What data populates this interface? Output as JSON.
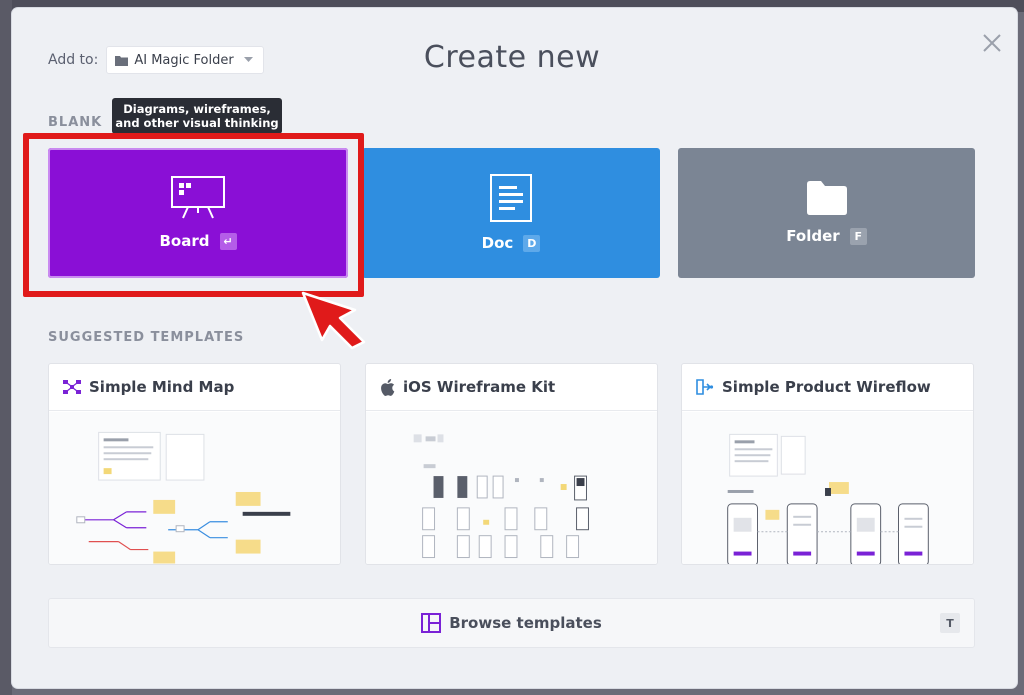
{
  "dialog": {
    "title": "Create new",
    "add_to_label": "Add to:",
    "folder_name": "AI Magic Folder"
  },
  "blank": {
    "section_label": "BLANK",
    "tooltip_line1": "Diagrams, wireframes,",
    "tooltip_line2": "and other visual thinking",
    "cards": [
      {
        "label": "Board",
        "shortcut": "↵",
        "icon": "board-icon",
        "color": "#8a0fd6"
      },
      {
        "label": "Doc",
        "shortcut": "D",
        "icon": "doc-icon",
        "color": "#2f8ee0"
      },
      {
        "label": "Folder",
        "shortcut": "F",
        "icon": "folder-icon",
        "color": "#7b8594"
      }
    ]
  },
  "templates": {
    "section_label": "SUGGESTED TEMPLATES",
    "items": [
      {
        "name": "Simple Mind Map",
        "icon": "mind-map-icon"
      },
      {
        "name": "iOS Wireframe Kit",
        "icon": "apple-icon"
      },
      {
        "name": "Simple Product Wireflow",
        "icon": "wireflow-icon"
      }
    ]
  },
  "browse": {
    "label": "Browse templates",
    "shortcut": "T",
    "icon": "templates-layout-icon"
  },
  "colors": {
    "accent_purple": "#8a0fd6",
    "doc_blue": "#2f8ee0",
    "folder_gray": "#7b8594",
    "highlight_red": "#e01a1a"
  }
}
